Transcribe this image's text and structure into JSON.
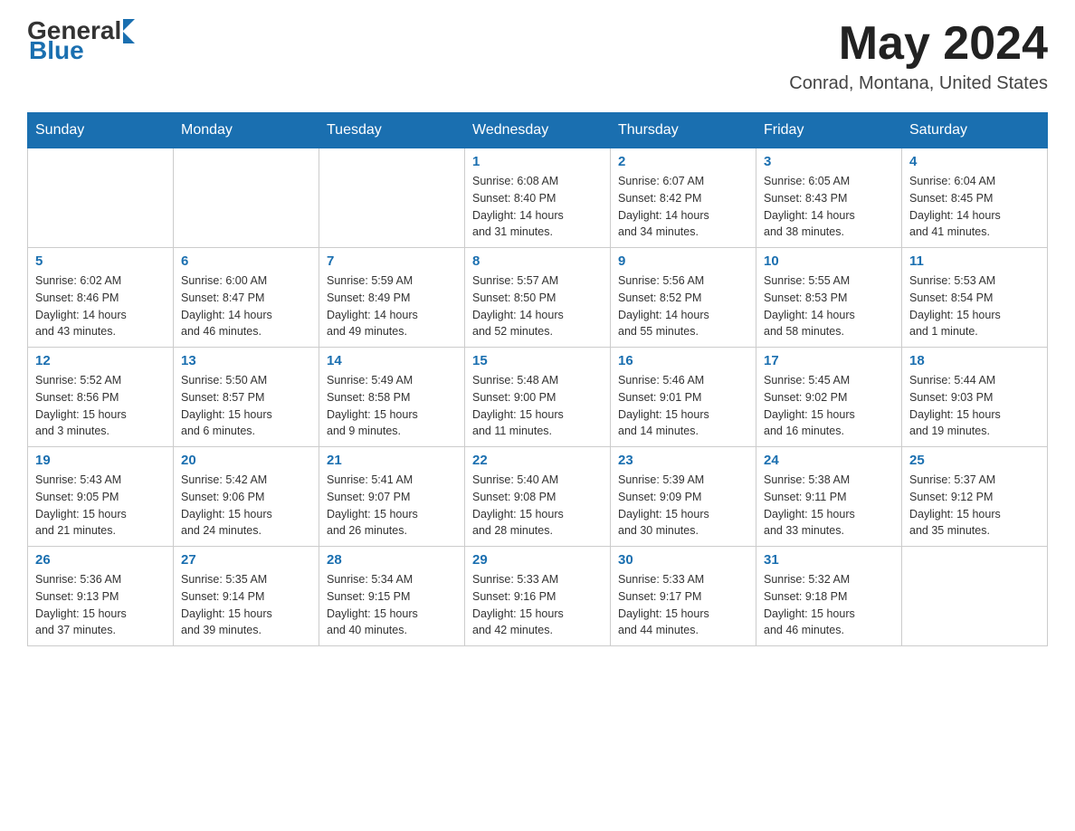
{
  "header": {
    "logo_general": "General",
    "logo_blue": "Blue",
    "month_year": "May 2024",
    "location": "Conrad, Montana, United States"
  },
  "weekdays": [
    "Sunday",
    "Monday",
    "Tuesday",
    "Wednesday",
    "Thursday",
    "Friday",
    "Saturday"
  ],
  "weeks": [
    [
      {
        "day": "",
        "info": ""
      },
      {
        "day": "",
        "info": ""
      },
      {
        "day": "",
        "info": ""
      },
      {
        "day": "1",
        "info": "Sunrise: 6:08 AM\nSunset: 8:40 PM\nDaylight: 14 hours\nand 31 minutes."
      },
      {
        "day": "2",
        "info": "Sunrise: 6:07 AM\nSunset: 8:42 PM\nDaylight: 14 hours\nand 34 minutes."
      },
      {
        "day": "3",
        "info": "Sunrise: 6:05 AM\nSunset: 8:43 PM\nDaylight: 14 hours\nand 38 minutes."
      },
      {
        "day": "4",
        "info": "Sunrise: 6:04 AM\nSunset: 8:45 PM\nDaylight: 14 hours\nand 41 minutes."
      }
    ],
    [
      {
        "day": "5",
        "info": "Sunrise: 6:02 AM\nSunset: 8:46 PM\nDaylight: 14 hours\nand 43 minutes."
      },
      {
        "day": "6",
        "info": "Sunrise: 6:00 AM\nSunset: 8:47 PM\nDaylight: 14 hours\nand 46 minutes."
      },
      {
        "day": "7",
        "info": "Sunrise: 5:59 AM\nSunset: 8:49 PM\nDaylight: 14 hours\nand 49 minutes."
      },
      {
        "day": "8",
        "info": "Sunrise: 5:57 AM\nSunset: 8:50 PM\nDaylight: 14 hours\nand 52 minutes."
      },
      {
        "day": "9",
        "info": "Sunrise: 5:56 AM\nSunset: 8:52 PM\nDaylight: 14 hours\nand 55 minutes."
      },
      {
        "day": "10",
        "info": "Sunrise: 5:55 AM\nSunset: 8:53 PM\nDaylight: 14 hours\nand 58 minutes."
      },
      {
        "day": "11",
        "info": "Sunrise: 5:53 AM\nSunset: 8:54 PM\nDaylight: 15 hours\nand 1 minute."
      }
    ],
    [
      {
        "day": "12",
        "info": "Sunrise: 5:52 AM\nSunset: 8:56 PM\nDaylight: 15 hours\nand 3 minutes."
      },
      {
        "day": "13",
        "info": "Sunrise: 5:50 AM\nSunset: 8:57 PM\nDaylight: 15 hours\nand 6 minutes."
      },
      {
        "day": "14",
        "info": "Sunrise: 5:49 AM\nSunset: 8:58 PM\nDaylight: 15 hours\nand 9 minutes."
      },
      {
        "day": "15",
        "info": "Sunrise: 5:48 AM\nSunset: 9:00 PM\nDaylight: 15 hours\nand 11 minutes."
      },
      {
        "day": "16",
        "info": "Sunrise: 5:46 AM\nSunset: 9:01 PM\nDaylight: 15 hours\nand 14 minutes."
      },
      {
        "day": "17",
        "info": "Sunrise: 5:45 AM\nSunset: 9:02 PM\nDaylight: 15 hours\nand 16 minutes."
      },
      {
        "day": "18",
        "info": "Sunrise: 5:44 AM\nSunset: 9:03 PM\nDaylight: 15 hours\nand 19 minutes."
      }
    ],
    [
      {
        "day": "19",
        "info": "Sunrise: 5:43 AM\nSunset: 9:05 PM\nDaylight: 15 hours\nand 21 minutes."
      },
      {
        "day": "20",
        "info": "Sunrise: 5:42 AM\nSunset: 9:06 PM\nDaylight: 15 hours\nand 24 minutes."
      },
      {
        "day": "21",
        "info": "Sunrise: 5:41 AM\nSunset: 9:07 PM\nDaylight: 15 hours\nand 26 minutes."
      },
      {
        "day": "22",
        "info": "Sunrise: 5:40 AM\nSunset: 9:08 PM\nDaylight: 15 hours\nand 28 minutes."
      },
      {
        "day": "23",
        "info": "Sunrise: 5:39 AM\nSunset: 9:09 PM\nDaylight: 15 hours\nand 30 minutes."
      },
      {
        "day": "24",
        "info": "Sunrise: 5:38 AM\nSunset: 9:11 PM\nDaylight: 15 hours\nand 33 minutes."
      },
      {
        "day": "25",
        "info": "Sunrise: 5:37 AM\nSunset: 9:12 PM\nDaylight: 15 hours\nand 35 minutes."
      }
    ],
    [
      {
        "day": "26",
        "info": "Sunrise: 5:36 AM\nSunset: 9:13 PM\nDaylight: 15 hours\nand 37 minutes."
      },
      {
        "day": "27",
        "info": "Sunrise: 5:35 AM\nSunset: 9:14 PM\nDaylight: 15 hours\nand 39 minutes."
      },
      {
        "day": "28",
        "info": "Sunrise: 5:34 AM\nSunset: 9:15 PM\nDaylight: 15 hours\nand 40 minutes."
      },
      {
        "day": "29",
        "info": "Sunrise: 5:33 AM\nSunset: 9:16 PM\nDaylight: 15 hours\nand 42 minutes."
      },
      {
        "day": "30",
        "info": "Sunrise: 5:33 AM\nSunset: 9:17 PM\nDaylight: 15 hours\nand 44 minutes."
      },
      {
        "day": "31",
        "info": "Sunrise: 5:32 AM\nSunset: 9:18 PM\nDaylight: 15 hours\nand 46 minutes."
      },
      {
        "day": "",
        "info": ""
      }
    ]
  ]
}
